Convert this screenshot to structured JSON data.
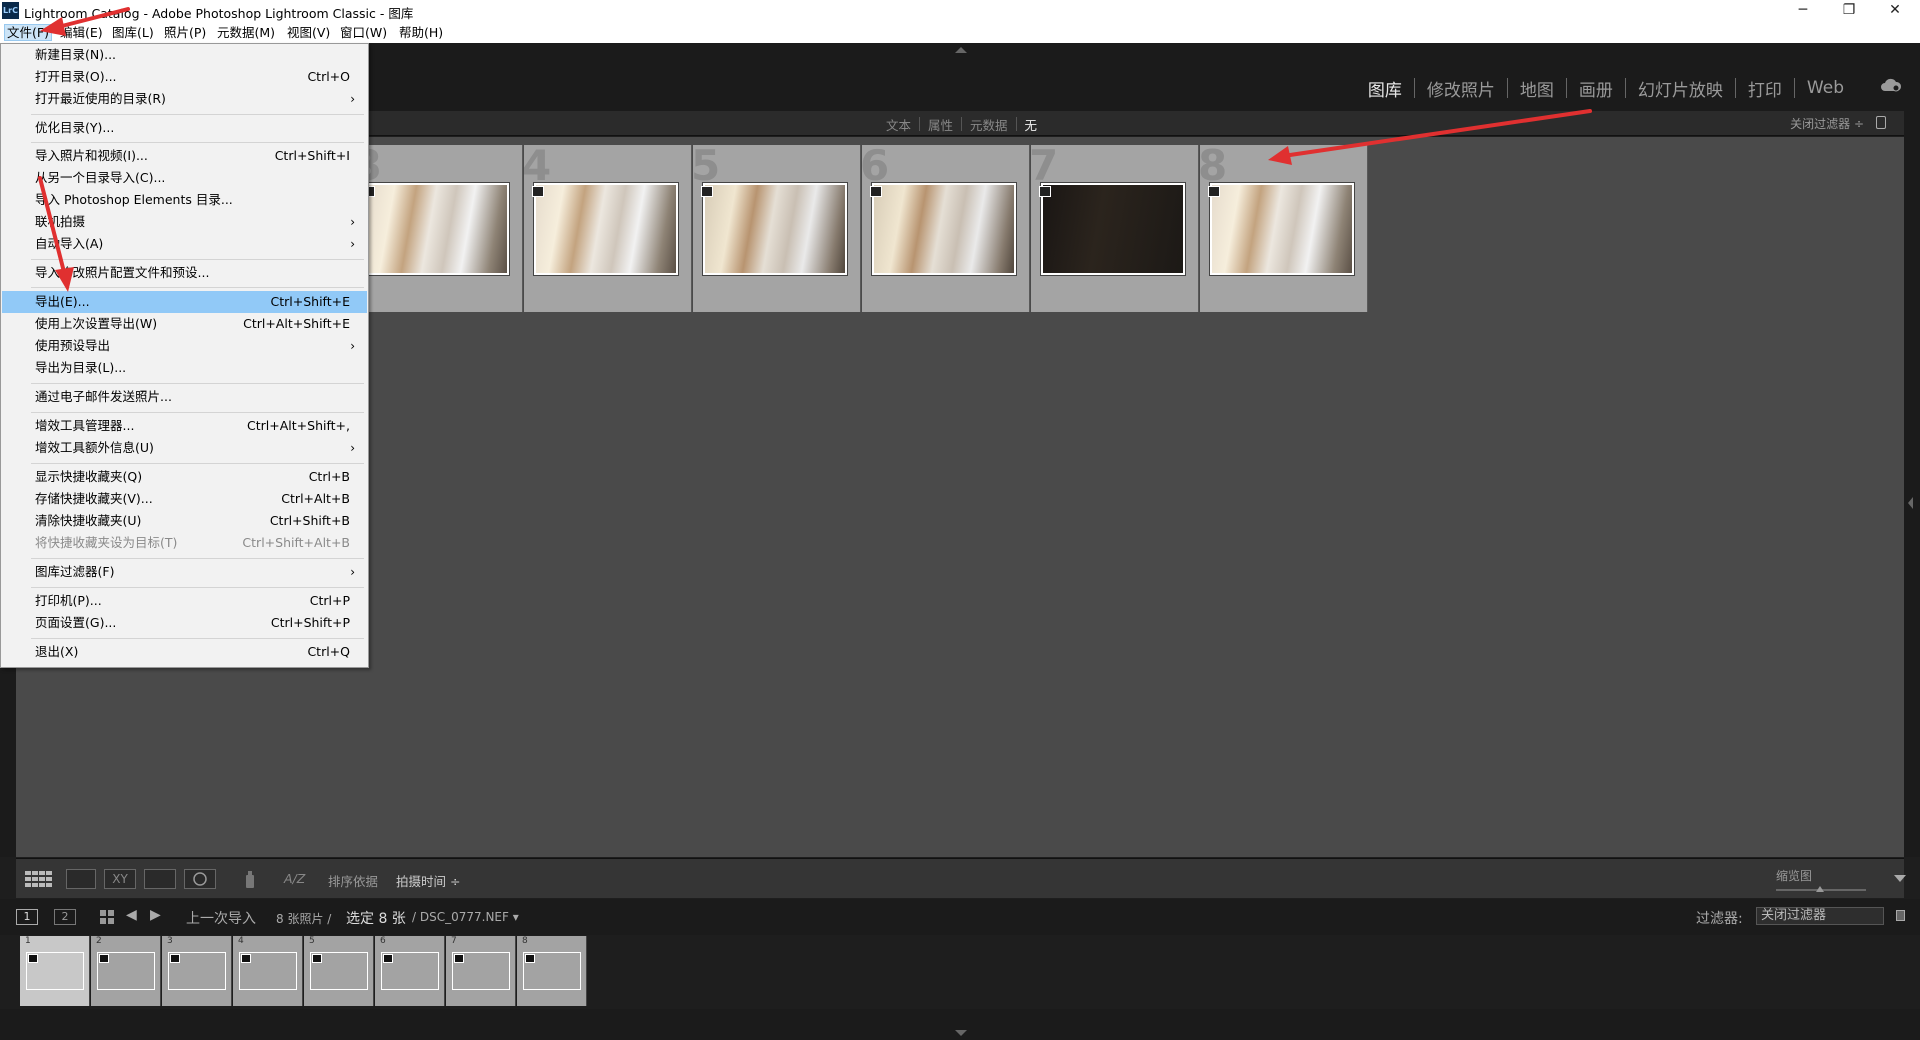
{
  "window": {
    "logo": "LrC",
    "title": "Lightroom Catalog - Adobe Photoshop Lightroom Classic - 图库",
    "minimize": "─",
    "restore": "❐",
    "close": "✕"
  },
  "menubar": [
    "文件(F)",
    "编辑(E)",
    "图库(L)",
    "照片(P)",
    "元数据(M)",
    "视图(V)",
    "窗口(W)",
    "帮助(H)"
  ],
  "modules": [
    "图库",
    "修改照片",
    "地图",
    "画册",
    "幻灯片放映",
    "打印",
    "Web"
  ],
  "filterbar": {
    "options": [
      "文本",
      "属性",
      "元数据",
      "无"
    ],
    "active": "无",
    "filter_off": "关闭过滤器 ÷"
  },
  "grid": {
    "cells": [
      {
        "num": "3"
      },
      {
        "num": "4"
      },
      {
        "num": "5"
      },
      {
        "num": "6"
      },
      {
        "num": "7"
      },
      {
        "num": "8"
      }
    ]
  },
  "toolbar": {
    "sort_label": "排序依据",
    "sort_value": "拍摄时间 ÷",
    "thumb_label": "缩览图",
    "az": "A/Z"
  },
  "filmstrip_header": {
    "page1": "1",
    "page2": "2",
    "source": "上一次导入",
    "count": "8 张照片 /",
    "selected": "选定 8 张",
    "filename": "/ DSC_0777.NEF ▾",
    "filter_label": "过滤器:",
    "filter_value": "关闭过滤器"
  },
  "filmstrip": [
    "1",
    "2",
    "3",
    "4",
    "5",
    "6",
    "7",
    "8"
  ],
  "file_menu": {
    "items": [
      {
        "label": "新建目录(N)...",
        "shortcut": ""
      },
      {
        "label": "打开目录(O)...",
        "shortcut": "Ctrl+O"
      },
      {
        "label": "打开最近使用的目录(R)",
        "shortcut": "",
        "submenu": true
      },
      {
        "sep": true
      },
      {
        "label": "优化目录(Y)...",
        "shortcut": ""
      },
      {
        "sep": true
      },
      {
        "label": "导入照片和视频(I)...",
        "shortcut": "Ctrl+Shift+I"
      },
      {
        "label": "从另一个目录导入(C)...",
        "shortcut": ""
      },
      {
        "label": "导入 Photoshop Elements 目录...",
        "shortcut": ""
      },
      {
        "label": "联机拍摄",
        "shortcut": "",
        "submenu": true
      },
      {
        "label": "自动导入(A)",
        "shortcut": "",
        "submenu": true
      },
      {
        "sep": true
      },
      {
        "label": "导入修改照片配置文件和预设...",
        "shortcut": ""
      },
      {
        "sep": true
      },
      {
        "label": "导出(E)...",
        "shortcut": "Ctrl+Shift+E",
        "highlight": true
      },
      {
        "label": "使用上次设置导出(W)",
        "shortcut": "Ctrl+Alt+Shift+E"
      },
      {
        "label": "使用预设导出",
        "shortcut": "",
        "submenu": true
      },
      {
        "label": "导出为目录(L)...",
        "shortcut": ""
      },
      {
        "sep": true
      },
      {
        "label": "通过电子邮件发送照片...",
        "shortcut": ""
      },
      {
        "sep": true
      },
      {
        "label": "增效工具管理器...",
        "shortcut": "Ctrl+Alt+Shift+,"
      },
      {
        "label": "增效工具额外信息(U)",
        "shortcut": "",
        "submenu": true
      },
      {
        "sep": true
      },
      {
        "label": "显示快捷收藏夹(Q)",
        "shortcut": "Ctrl+B"
      },
      {
        "label": "存储快捷收藏夹(V)...",
        "shortcut": "Ctrl+Alt+B"
      },
      {
        "label": "清除快捷收藏夹(U)",
        "shortcut": "Ctrl+Shift+B"
      },
      {
        "label": "将快捷收藏夹设为目标(T)",
        "shortcut": "Ctrl+Shift+Alt+B",
        "disabled": true
      },
      {
        "sep": true
      },
      {
        "label": "图库过滤器(F)",
        "shortcut": "",
        "submenu": true
      },
      {
        "sep": true
      },
      {
        "label": "打印机(P)...",
        "shortcut": "Ctrl+P"
      },
      {
        "label": "页面设置(G)...",
        "shortcut": "Ctrl+Shift+P"
      },
      {
        "sep": true
      },
      {
        "label": "退出(X)",
        "shortcut": "Ctrl+Q"
      }
    ]
  },
  "colors": {
    "annotation_arrow": "#e03030",
    "menu_highlight": "#91c9f7"
  }
}
